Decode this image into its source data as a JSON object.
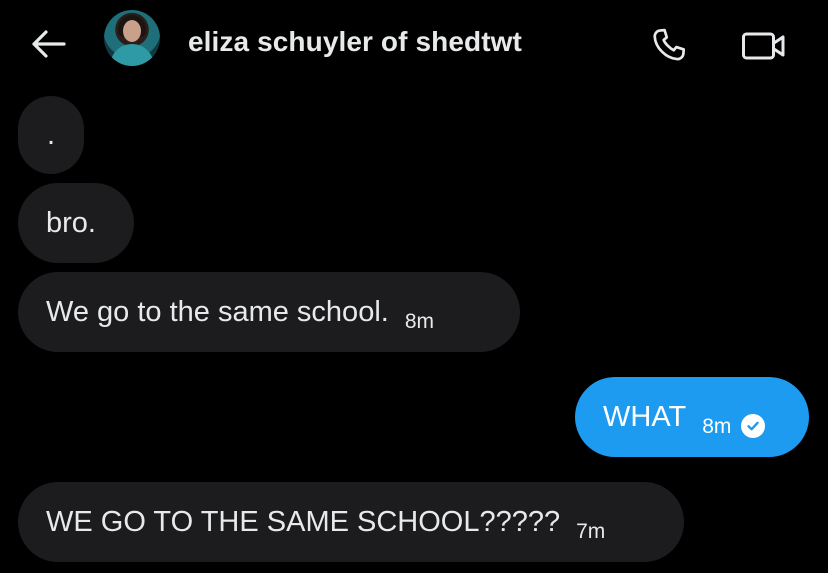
{
  "header": {
    "title": "eliza schuyler of shedtwt",
    "icons": {
      "back": "arrow-left-icon",
      "call": "phone-icon",
      "video": "video-camera-icon"
    }
  },
  "messages": [
    {
      "direction": "received",
      "text": ".",
      "time": ""
    },
    {
      "direction": "received",
      "text": "bro.",
      "time": ""
    },
    {
      "direction": "received",
      "text": "We go to the same school.",
      "time": "8m"
    },
    {
      "direction": "sent",
      "text": "WHAT",
      "time": "8m",
      "status": "seen-check-icon"
    },
    {
      "direction": "received",
      "text": "WE GO TO THE SAME SCHOOL?????",
      "time": "7m"
    }
  ],
  "colors": {
    "background": "#000000",
    "received_bubble": "#1c1c1e",
    "sent_bubble": "#1d9bf0",
    "text": "#e7e9ea"
  }
}
